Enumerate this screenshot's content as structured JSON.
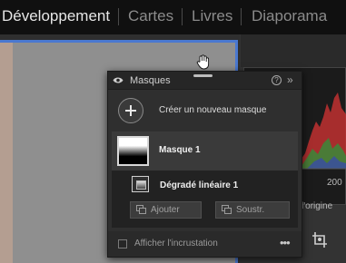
{
  "modules": {
    "items": [
      {
        "label": "Développement",
        "active": true
      },
      {
        "label": "Cartes",
        "active": false
      },
      {
        "label": "Livres",
        "active": false
      },
      {
        "label": "Diaporama",
        "active": false
      }
    ]
  },
  "right_panel": {
    "axis_value": "200",
    "origin_label": "l'origine",
    "transform_icon": "crop-transform-icon"
  },
  "masks_panel": {
    "title": "Masques",
    "help_icon": "help-icon",
    "close_icon": "double-chevron-right-icon",
    "create_label": "Créer un nouveau masque",
    "mask": {
      "name": "Masque 1",
      "component": "Dégradé linéaire 1"
    },
    "add_button": "Ajouter",
    "subtract_button": "Soustr.",
    "overlay_label": "Afficher l'incrustation",
    "overlay_checked": false,
    "more_icon": "more-icon"
  },
  "colors": {
    "accent_border": "#4a78d0",
    "panel_bg": "#2f2f2f",
    "selected_row": "#3a3a3a"
  }
}
